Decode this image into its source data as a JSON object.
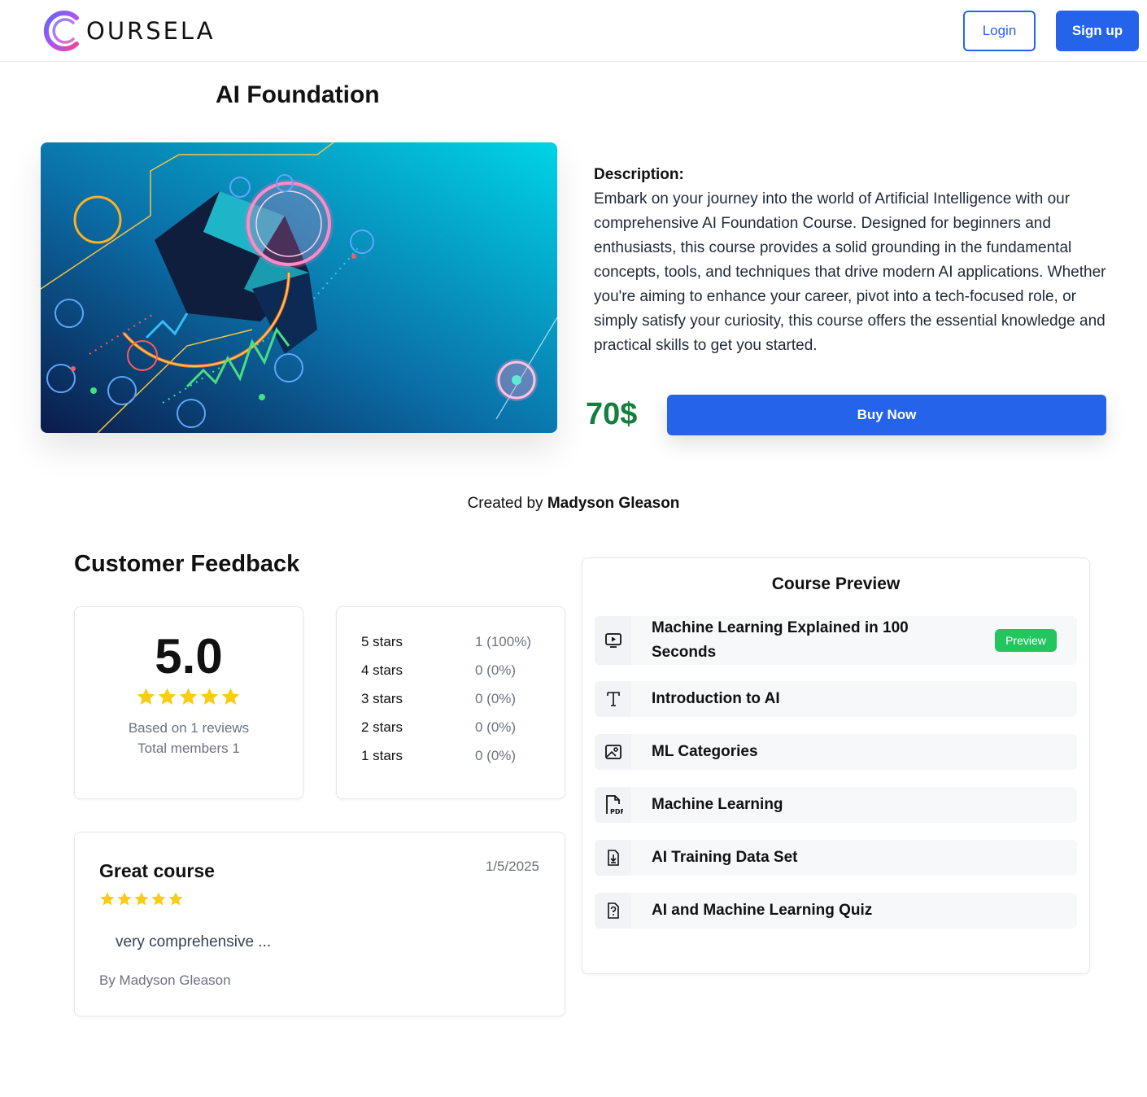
{
  "header": {
    "brand_rest": "OURSELA",
    "login_label": "Login",
    "signup_label": "Sign up"
  },
  "course": {
    "title": "AI Foundation",
    "description_label": "Description:",
    "description": "Embark on your journey into the world of Artificial Intelligence with our comprehensive AI Foundation Course. Designed for beginners and enthusiasts, this course provides a solid grounding in the fundamental concepts, tools, and techniques that drive modern AI applications. Whether you're aiming to enhance your career, pivot into a tech-focused role, or simply satisfy your curiosity, this course offers the essential knowledge and practical skills to get you started.",
    "price": "70$",
    "buy_label": "Buy Now",
    "created_by_prefix": "Created by",
    "creator_name": "Madyson Gleason"
  },
  "feedback": {
    "title": "Customer Feedback",
    "score": "5.0",
    "score_stars": 5,
    "based_on": "Based on 1 reviews",
    "total_members": "Total members 1",
    "breakdown": [
      {
        "label": "5 stars",
        "value": "1 (100%)"
      },
      {
        "label": "4 stars",
        "value": "0 (0%)"
      },
      {
        "label": "3 stars",
        "value": "0 (0%)"
      },
      {
        "label": "2 stars",
        "value": "0 (0%)"
      },
      {
        "label": "1 stars",
        "value": "0 (0%)"
      }
    ],
    "review": {
      "title": "Great course",
      "date": "1/5/2025",
      "stars": 5,
      "text": "very comprehensive ...",
      "author": "By Madyson Gleason"
    }
  },
  "preview": {
    "title": "Course Preview",
    "items": [
      {
        "label": "Machine Learning Explained in 100 Seconds",
        "icon": "video-icon",
        "badge": "Preview"
      },
      {
        "label": "Introduction to AI",
        "icon": "text-icon"
      },
      {
        "label": "ML Categories",
        "icon": "image-icon"
      },
      {
        "label": "Machine Learning",
        "icon": "pdf-icon"
      },
      {
        "label": "AI Training Data Set",
        "icon": "download-file-icon"
      },
      {
        "label": "AI and Machine Learning Quiz",
        "icon": "quiz-icon"
      }
    ]
  },
  "colors": {
    "primary": "#2563eb",
    "price": "#15803d",
    "badge": "#22c55e",
    "star": "#facc15"
  }
}
